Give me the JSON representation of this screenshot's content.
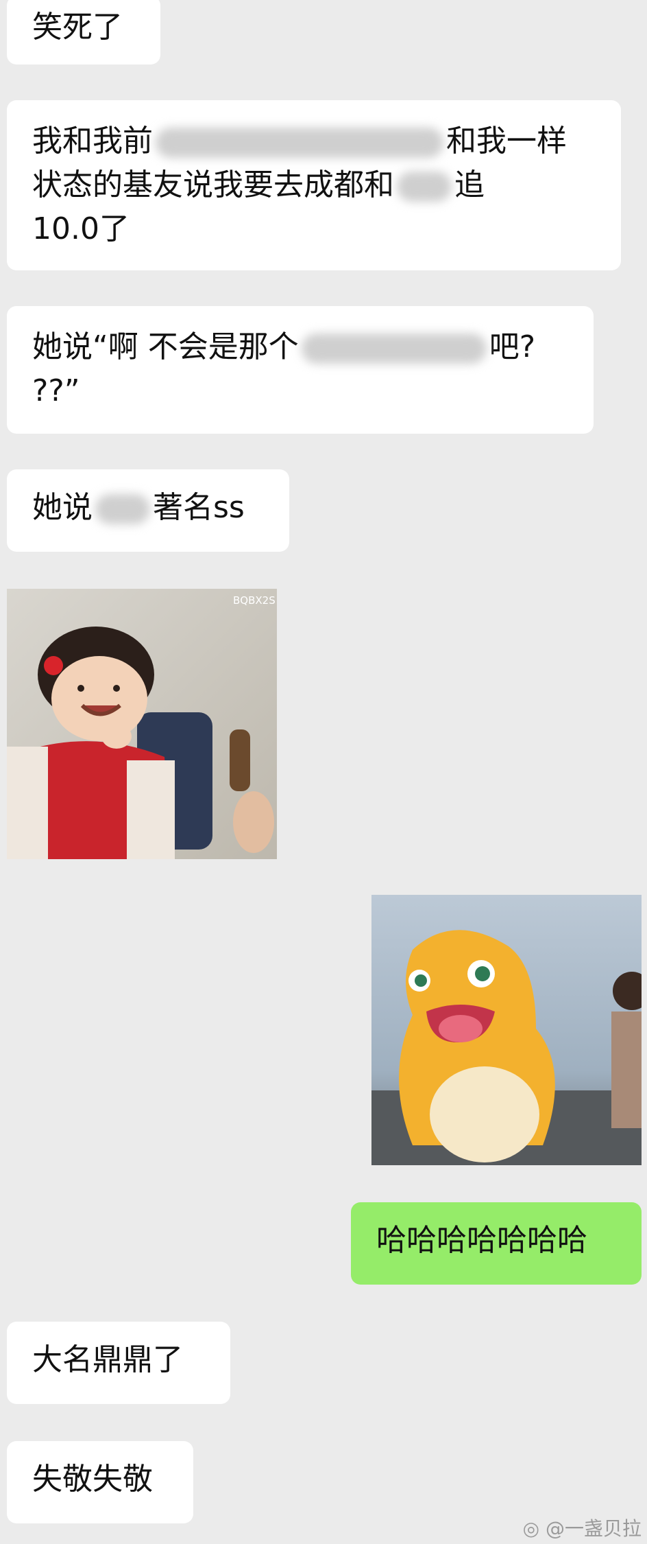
{
  "messages": [
    {
      "side": "left",
      "text": "笑死了"
    },
    {
      "side": "left",
      "lines": [
        "我和我前",
        "和我一样",
        "状态的基友说我要去成都和",
        "追",
        "10.0了"
      ]
    },
    {
      "side": "left",
      "lines": [
        "她说“啊 不会是那个",
        "吧?",
        "??”"
      ]
    },
    {
      "side": "left",
      "parts": [
        "她说",
        "著名ss"
      ]
    },
    {
      "side": "left",
      "image": "laughing-child-sticker",
      "image_label": "BQBX2S"
    },
    {
      "side": "right",
      "image": "yellow-dino-sticker"
    },
    {
      "side": "right",
      "text": "哈哈哈哈哈哈哈"
    },
    {
      "side": "left",
      "text": "大名鼎鼎了"
    },
    {
      "side": "left",
      "text": "失敬失敬"
    }
  ],
  "watermark": "@一盏贝拉",
  "colors": {
    "background": "#ebebeb",
    "bubble_in": "#ffffff",
    "bubble_out": "#95ec69"
  }
}
